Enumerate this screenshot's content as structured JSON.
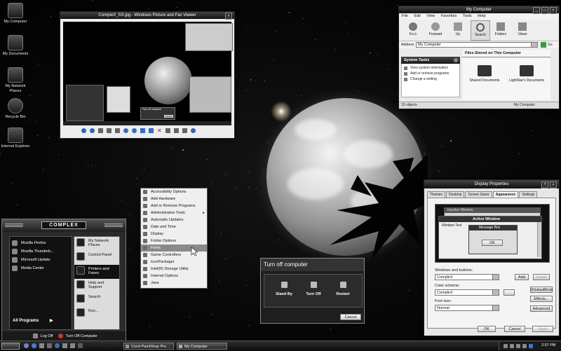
{
  "desktop_icons": [
    {
      "label": "My Computer",
      "icon": "computer-icon"
    },
    {
      "label": "My Documents",
      "icon": "documents-icon"
    },
    {
      "label": "My Network Places",
      "icon": "network-icon"
    },
    {
      "label": "Recycle Bin",
      "icon": "recycle-bin-icon"
    },
    {
      "label": "Internet Explorer",
      "icon": "ie-icon"
    }
  ],
  "viewer": {
    "title": "CompleX_SS.jpg - Windows Picture and Fax Viewer",
    "thumbnail": {
      "dialog_title": "Turn off computer",
      "dialog_button": "Cancel"
    }
  },
  "mycomputer": {
    "title": "My Computer",
    "menu": [
      "File",
      "Edit",
      "View",
      "Favorites",
      "Tools",
      "Help"
    ],
    "toolbar": {
      "back": "Back",
      "forward": "Forward",
      "up": "Up",
      "search": "Search",
      "folders": "Folders",
      "views": "Views"
    },
    "address_label": "Address",
    "address_value": "My Computer",
    "go": "Go",
    "tasks_title": "System Tasks",
    "tasks": [
      "View system information",
      "Add or remove programs",
      "Change a setting"
    ],
    "files_title": "Files Stored on This Computer",
    "items": [
      "Shared Documents",
      "LightStar's Documents"
    ],
    "status_count": "19 objects",
    "status_location": "My Computer"
  },
  "submenu": {
    "items": [
      "Accessibility Options",
      "Add Hardware",
      "Add or Remove Programs",
      "Administrative Tools",
      "Automatic Updates",
      "Date and Time",
      "Display",
      "Folder Options",
      "Fonts",
      "Game Controllers",
      "IconPackager",
      "Intel(R) Storage Utility",
      "Internet Options",
      "Java"
    ],
    "selected": "Fonts"
  },
  "startmenu": {
    "brand": "COMPLEX",
    "left": [
      "Mozilla Firefox",
      "Mozilla Thunderb...",
      "Microsoft Update",
      "Media Center"
    ],
    "all_programs": "All Programs",
    "right": [
      "My Network Places",
      "Control Panel",
      "Printers and Faxes",
      "Help and Support",
      "Search",
      "Run..."
    ],
    "logoff": "Log Off",
    "turnoff": "Turn Off Computer"
  },
  "turnoff": {
    "title": "Turn off computer",
    "standby": "Stand By",
    "turnoff": "Turn Off",
    "restart": "Restart",
    "cancel": "Cancel"
  },
  "display": {
    "title": "Display Properties",
    "tabs": [
      "Themes",
      "Desktop",
      "Screen Saver",
      "Appearance",
      "Settings"
    ],
    "active_tab": "Appearance",
    "preview": {
      "inactive": "Inactive Window",
      "active": "Active Window",
      "window_text": "Window Text",
      "message_box": "Message Box",
      "ok": "OK"
    },
    "windows_buttons_label": "Windows and buttons:",
    "windows_buttons_value": "CompleX",
    "color_scheme_label": "Color scheme:",
    "color_scheme_value": "CompleX",
    "font_size_label": "Font size:",
    "font_size_value": "Normal",
    "add": "Add",
    "delete": "Delete",
    "windowblinds": "WindowBlinds",
    "effects": "Effects...",
    "advanced": "Advanced",
    "ok": "OK",
    "cancel": "Cancel",
    "apply": "Apply"
  },
  "taskbar": {
    "apps": [
      "Corel PaintShop Pro ...",
      "My Computer"
    ],
    "clock": "2:57 PM"
  },
  "colors": {
    "accent": "#8a8a8a",
    "window_bg": "#e9e9e9",
    "titlebar": "#1a1a1a"
  }
}
